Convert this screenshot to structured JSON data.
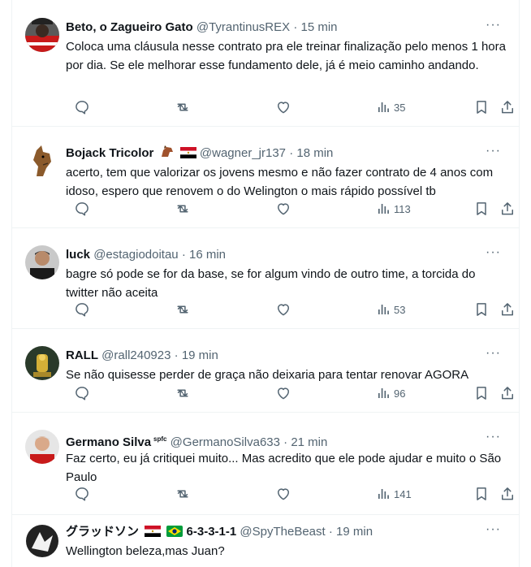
{
  "tweets": [
    {
      "name": "Beto, o Zagueiro Gato",
      "handle": "@TyrantinusREX",
      "time": "15 min",
      "text": "Coloca uma cláusula nesse contrato pra ele treinar finalização pelo menos 1 hora por dia. Se ele melhorar esse fundamento dele, já é meio caminho andando.",
      "views": "35"
    },
    {
      "name": "Bojack Tricolor",
      "handle": "@wagner_jr137",
      "time": "18 min",
      "text": "acerto, tem que valorizar os jovens mesmo e não fazer contrato de 4 anos com idoso, espero que renovem o do Welington o mais rápido possível tb",
      "views": "113"
    },
    {
      "name": "luck",
      "handle": "@estagiodoitau",
      "time": "16 min",
      "text": "bagre só pode se for da base, se for algum vindo de outro time, a torcida do twitter não aceita",
      "views": "53"
    },
    {
      "name": "RALL",
      "handle": "@rall240923",
      "time": "19 min",
      "text": "Se não quisesse perder de graça não deixaria para tentar renovar AGORA",
      "views": "96"
    },
    {
      "name": "Germano Silva",
      "name_sup": "spfc",
      "handle": "@GermanoSilva633",
      "time": "21 min",
      "text": "Faz certo, eu já critiquei muito... Mas acredito que ele pode ajudar e muito o São Paulo",
      "views": "141"
    },
    {
      "name": "グラッドソン",
      "name_suffix": "6-3-3-1-1",
      "handle": "@SpyTheBeast",
      "time": "19 min",
      "text": "Wellington beleza,mas Juan?",
      "views": ""
    }
  ],
  "common": {
    "separator": "·",
    "more": "···"
  },
  "icons": {
    "reply": "reply-icon",
    "retweet": "retweet-icon",
    "like": "like-icon",
    "views": "views-icon",
    "bookmark": "bookmark-icon",
    "share": "share-icon",
    "more": "more-icon"
  }
}
